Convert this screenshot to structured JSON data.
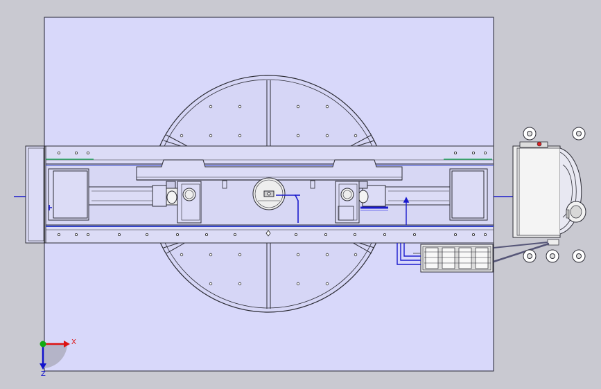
{
  "colors": {
    "viewport_bg": "#c9c9d1",
    "plate_fill": "#d8d8fa",
    "plate_stroke": "#222233",
    "part_fill": "#dcdcf6",
    "part_stroke": "#2a2a33",
    "pipe": "#1a1acc",
    "pipe_light": "#7070ee",
    "detail_fill": "#eeeeee",
    "axis_x": "#dd1111",
    "axis_y": "#1111cc",
    "axis_origin": "#11aa11"
  },
  "axes": {
    "x_label": "X",
    "z_label": "Z"
  },
  "icons": {
    "triad": "coordinate-triad-icon"
  }
}
